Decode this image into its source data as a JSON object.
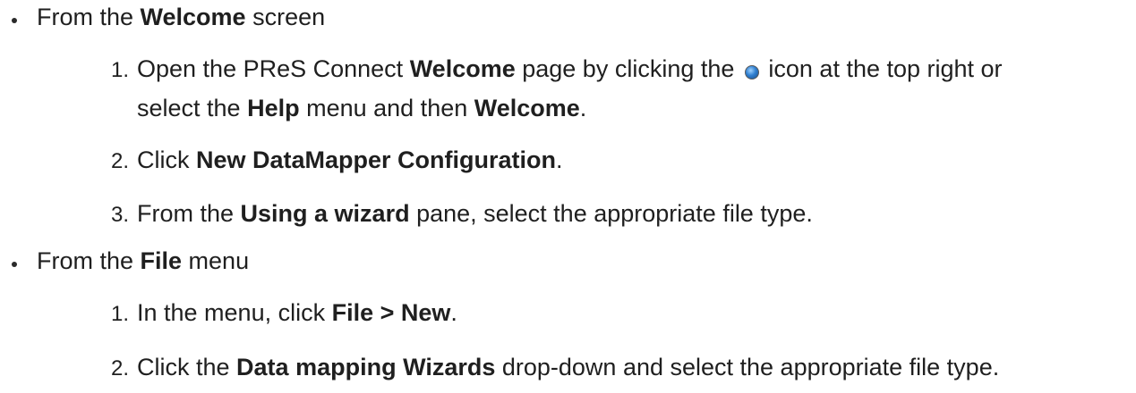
{
  "sections": [
    {
      "intro_pre": "From the ",
      "intro_bold": "Welcome",
      "intro_post": " screen",
      "steps": [
        {
          "num": "1.",
          "line1": {
            "a": "Open the PReS Connect ",
            "b": "Welcome",
            "c": " page by clicking the ",
            "icon": "welcome-home-icon",
            "d": " icon at the top right or"
          },
          "line2": {
            "a": "select the ",
            "b": "Help",
            "c": " menu and then ",
            "d": "Welcome",
            "e": "."
          }
        },
        {
          "num": "2.",
          "a": "Click ",
          "b": "New DataMapper Configuration",
          "c": "."
        },
        {
          "num": "3.",
          "a": "From the ",
          "b": "Using a wizard",
          "c": " pane, select the appropriate file type."
        }
      ]
    },
    {
      "intro_pre": "From the ",
      "intro_bold": "File",
      "intro_post": " menu",
      "steps": [
        {
          "num": "1.",
          "a": "In the menu, click ",
          "b": "File > New",
          "c": "."
        },
        {
          "num": "2.",
          "a": "Click the ",
          "b": "Data mapping Wizards",
          "c": " drop-down and select the appropriate file type."
        }
      ]
    }
  ]
}
